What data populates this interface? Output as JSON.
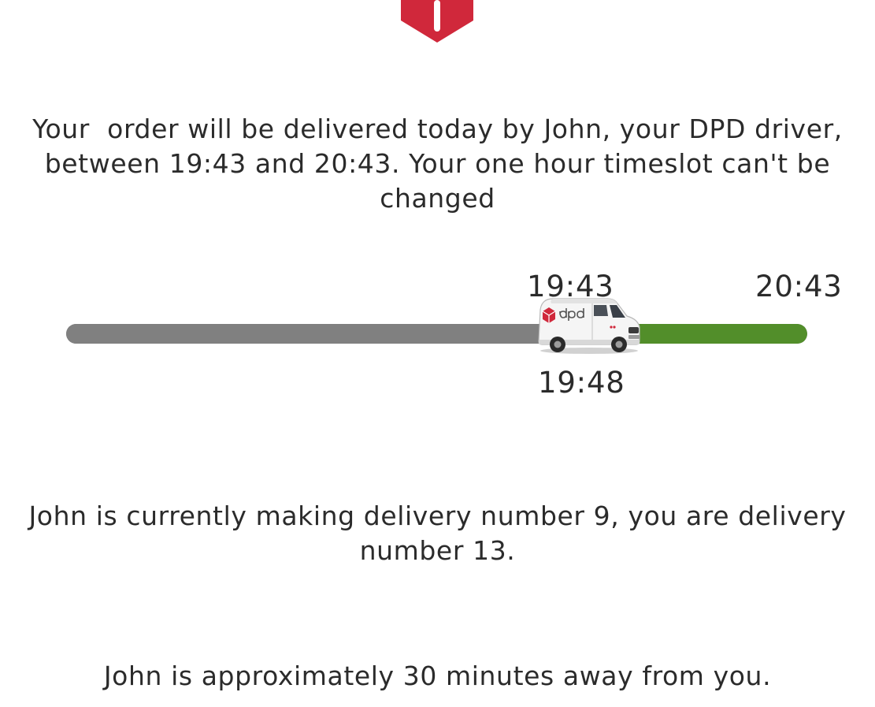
{
  "brand": {
    "logo_icon": "dpd-parcel-logo-icon",
    "color": "#d0283b"
  },
  "message_eta": "Your  order will be delivered today by John, your DPD driver, between 19:43 and 20:43. Your one hour timeslot can't be changed",
  "timeline": {
    "window_start": "19:43",
    "window_end": "20:43",
    "estimated_time": "19:48",
    "vehicle_icon": "dpd-van-icon",
    "progress_fraction": 0.735,
    "colors": {
      "elapsed": "#808080",
      "remaining": "#528e2a"
    }
  },
  "message_stops": "John is currently making delivery number 9, you are delivery number 13.",
  "message_distance": "John is approximately 30 minutes away from you."
}
